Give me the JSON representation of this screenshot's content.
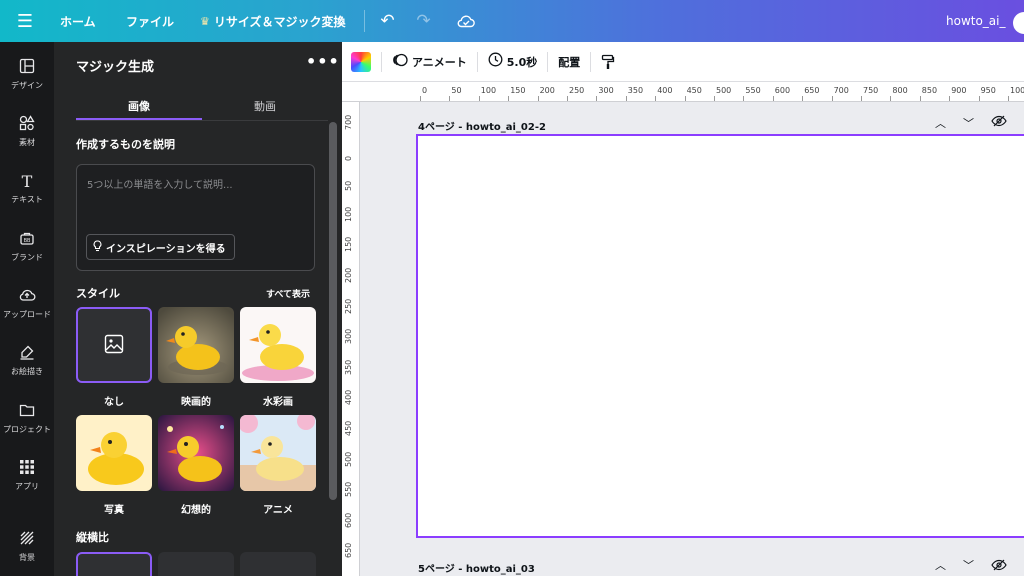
{
  "topbar": {
    "menu_icon": "hamburger-icon",
    "home": "ホーム",
    "file": "ファイル",
    "resize": "リサイズ＆マジック変換",
    "title": "howto_ai_"
  },
  "rail": {
    "items": [
      {
        "label": "デザイン",
        "icon": "layout-icon"
      },
      {
        "label": "素材",
        "icon": "elements-icon"
      },
      {
        "label": "テキスト",
        "icon": "text-icon"
      },
      {
        "label": "ブランド",
        "icon": "brand-icon"
      },
      {
        "label": "アップロード",
        "icon": "upload-icon"
      },
      {
        "label": "お絵描き",
        "icon": "draw-icon"
      },
      {
        "label": "プロジェクト",
        "icon": "folder-icon"
      },
      {
        "label": "アプリ",
        "icon": "apps-icon"
      },
      {
        "label": "背景",
        "icon": "background-icon"
      }
    ]
  },
  "panel": {
    "title": "マジック生成",
    "tabs": [
      "画像",
      "動画"
    ],
    "description_label": "作成するものを説明",
    "prompt_placeholder": "5つ以上の単語を入力して説明...",
    "inspiration_button": "インスピレーションを得る",
    "style_label": "スタイル",
    "show_all": "すべて表示",
    "styles": [
      "なし",
      "映画的",
      "水彩画",
      "写真",
      "幻想的",
      "アニメ"
    ],
    "ratio_label": "縦横比"
  },
  "toolbar": {
    "animate": "アニメート",
    "duration": "5.0秒",
    "arrange": "配置"
  },
  "ruler": {
    "h_ticks": [
      "0",
      "50",
      "100",
      "150",
      "200",
      "250",
      "300",
      "350",
      "400",
      "450",
      "500",
      "550",
      "600",
      "650",
      "700",
      "750",
      "800",
      "850",
      "900",
      "950",
      "100"
    ],
    "v_ticks": [
      "700",
      "0",
      "50",
      "100",
      "150",
      "200",
      "250",
      "300",
      "350",
      "400",
      "450",
      "500",
      "550",
      "600",
      "650"
    ]
  },
  "canvas": {
    "page4_title": "4ページ - howto_ai_02-2",
    "page5_title": "5ページ - howto_ai_03"
  },
  "colors": {
    "accent": "#8b3dff",
    "panel_bg": "#252627",
    "rail_bg": "#18191b"
  }
}
